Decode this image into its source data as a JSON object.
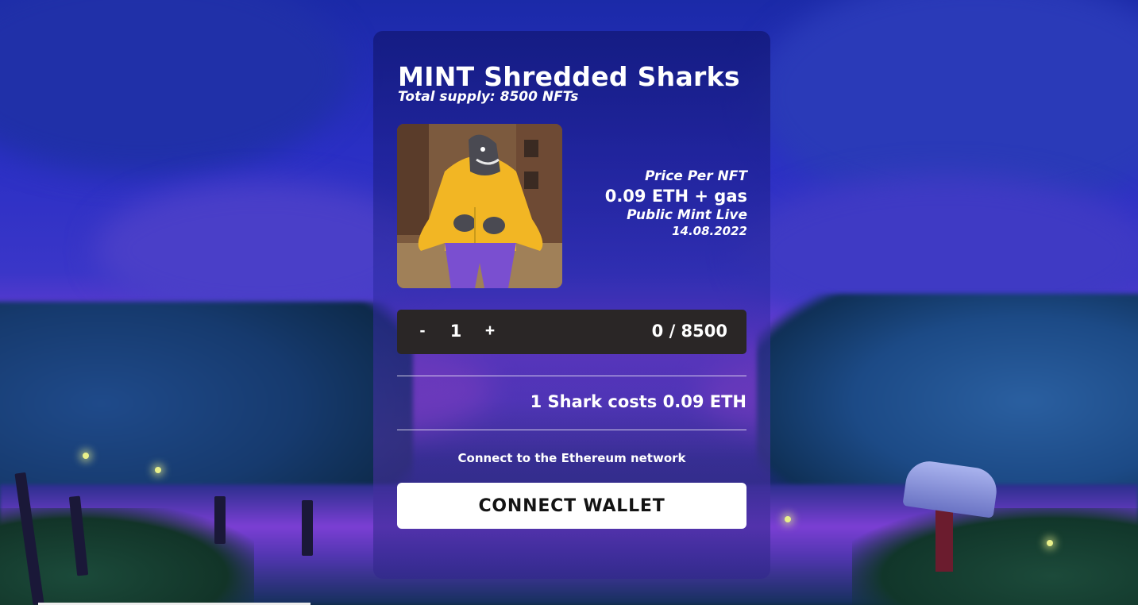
{
  "mint": {
    "title": "MINT Shredded Sharks",
    "supply_text": "Total supply: 8500 NFTs",
    "price_label": "Price Per NFT",
    "price_value": "0.09 ETH + gas",
    "mint_label": "Public Mint Live",
    "mint_date": "14.08.2022"
  },
  "quantity": {
    "minus_label": "-",
    "value": "1",
    "plus_label": "+",
    "supply_progress": "0 / 8500"
  },
  "summary": {
    "cost_text": "1 Shark costs 0.09 ETH",
    "network_text": "Connect to the Ethereum network",
    "connect_label": "CONNECT WALLET"
  },
  "colors": {
    "card_background": "#1a1e8a",
    "quantity_bar": "#2a2626",
    "button_background": "#ffffff",
    "hoodie": "#f2b624",
    "pants": "#7a4fd0"
  }
}
